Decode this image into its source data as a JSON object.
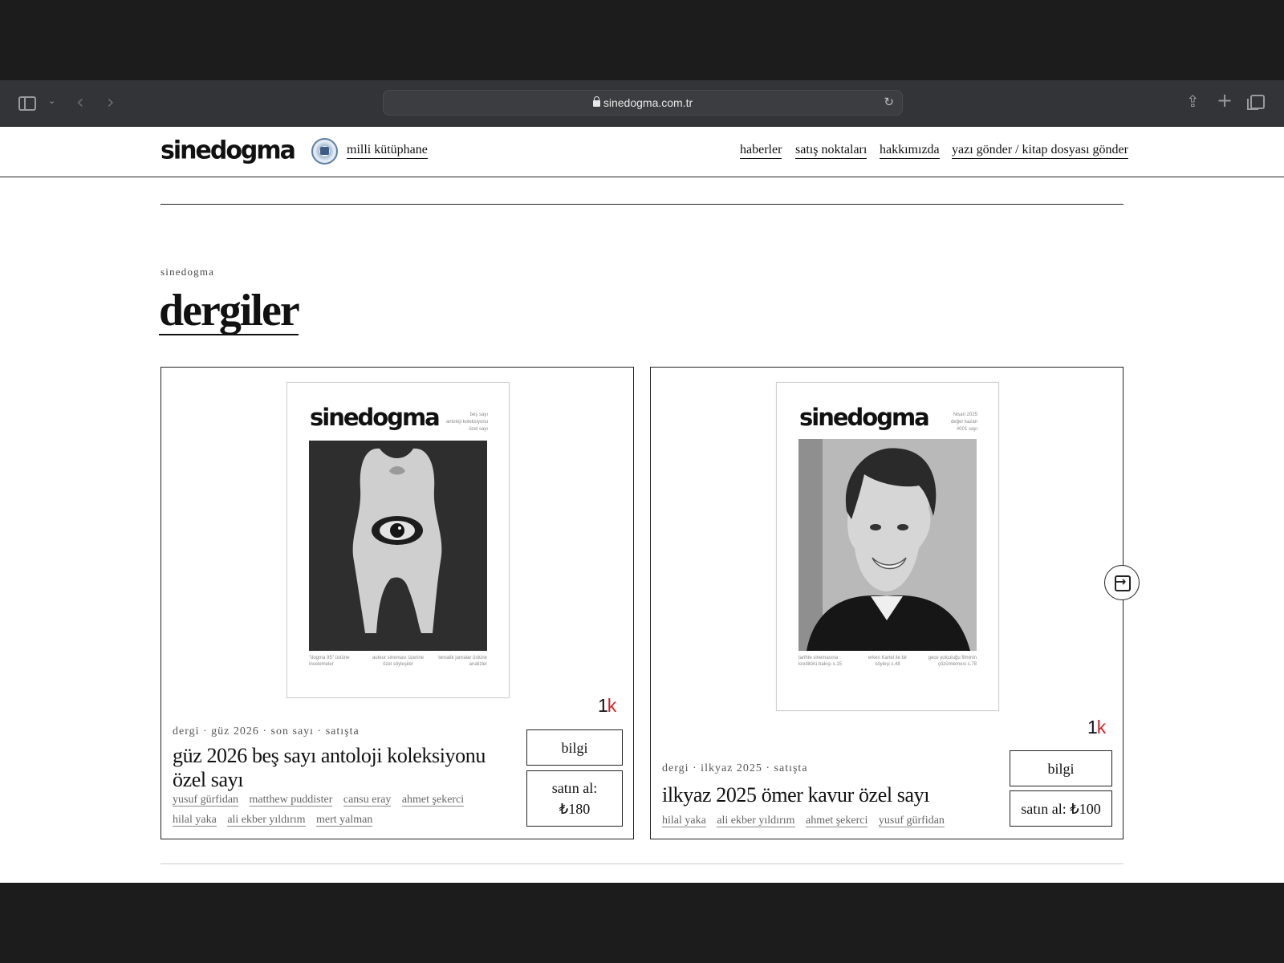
{
  "browser": {
    "url": "sinedogma.com.tr",
    "icons": [
      "sidebar-icon",
      "chevron-down-icon",
      "back-icon",
      "forward-icon",
      "lock-icon",
      "reload-icon",
      "share-icon",
      "new-tab-icon",
      "tab-overview-icon"
    ]
  },
  "header": {
    "logo": "sinedogma",
    "library_link": "milli kütüphane",
    "nav": [
      "haberler",
      "satış noktaları",
      "hakkımızda",
      "yazı gönder / kitap dosyası gönder"
    ]
  },
  "section": {
    "kicker": "sinedogma",
    "title": "dergiler"
  },
  "issues": [
    {
      "cover_logo": "sinedogma",
      "cover_tag": [
        "beş sayı",
        "antoloji koleksiyonu",
        "özel sayı"
      ],
      "cover_notes": [
        "\"dogma 95\" üstüne incelemeler",
        "auteur sineması üzerine özel söyleşiler",
        "tematik janralar üstüne analizler"
      ],
      "badge_prefix": "1",
      "badge_suffix": "k",
      "meta": "dergi · güz 2026 · son sayı · satışta",
      "title": "güz 2026 beş sayı antoloji koleksiyonu özel sayı",
      "authors": [
        "yusuf gürfidan",
        "matthew puddister",
        "cansu eray",
        "ahmet şekerci",
        "hilal yaka",
        "ali ekber yıldırım",
        "mert yalman"
      ],
      "info_label": "bilgi",
      "buy_label": "satın al: ₺180"
    },
    {
      "cover_logo": "sinedogma",
      "cover_tag": [
        "Nisan 2025",
        "değer kazan",
        "#001 sayı"
      ],
      "cover_notes": [
        "tarihte sinemasına kreditörü bakışı s.15",
        "erken Kartel ile bir söyleşi s.48",
        "gece yolculuğu filminin çözümlemesi s.78"
      ],
      "badge_prefix": "1",
      "badge_suffix": "k",
      "meta": "dergi · ilkyaz 2025 · satışta",
      "title": "ilkyaz 2025 ömer kavur özel sayı",
      "authors": [
        "hilal yaka",
        "ali ekber yıldırım",
        "ahmet şekerci",
        "yusuf gürfidan"
      ],
      "info_label": "bilgi",
      "buy_label": "satın al: ₺100"
    }
  ],
  "carousel": {
    "next_icon": "arrow-right-box-icon"
  }
}
